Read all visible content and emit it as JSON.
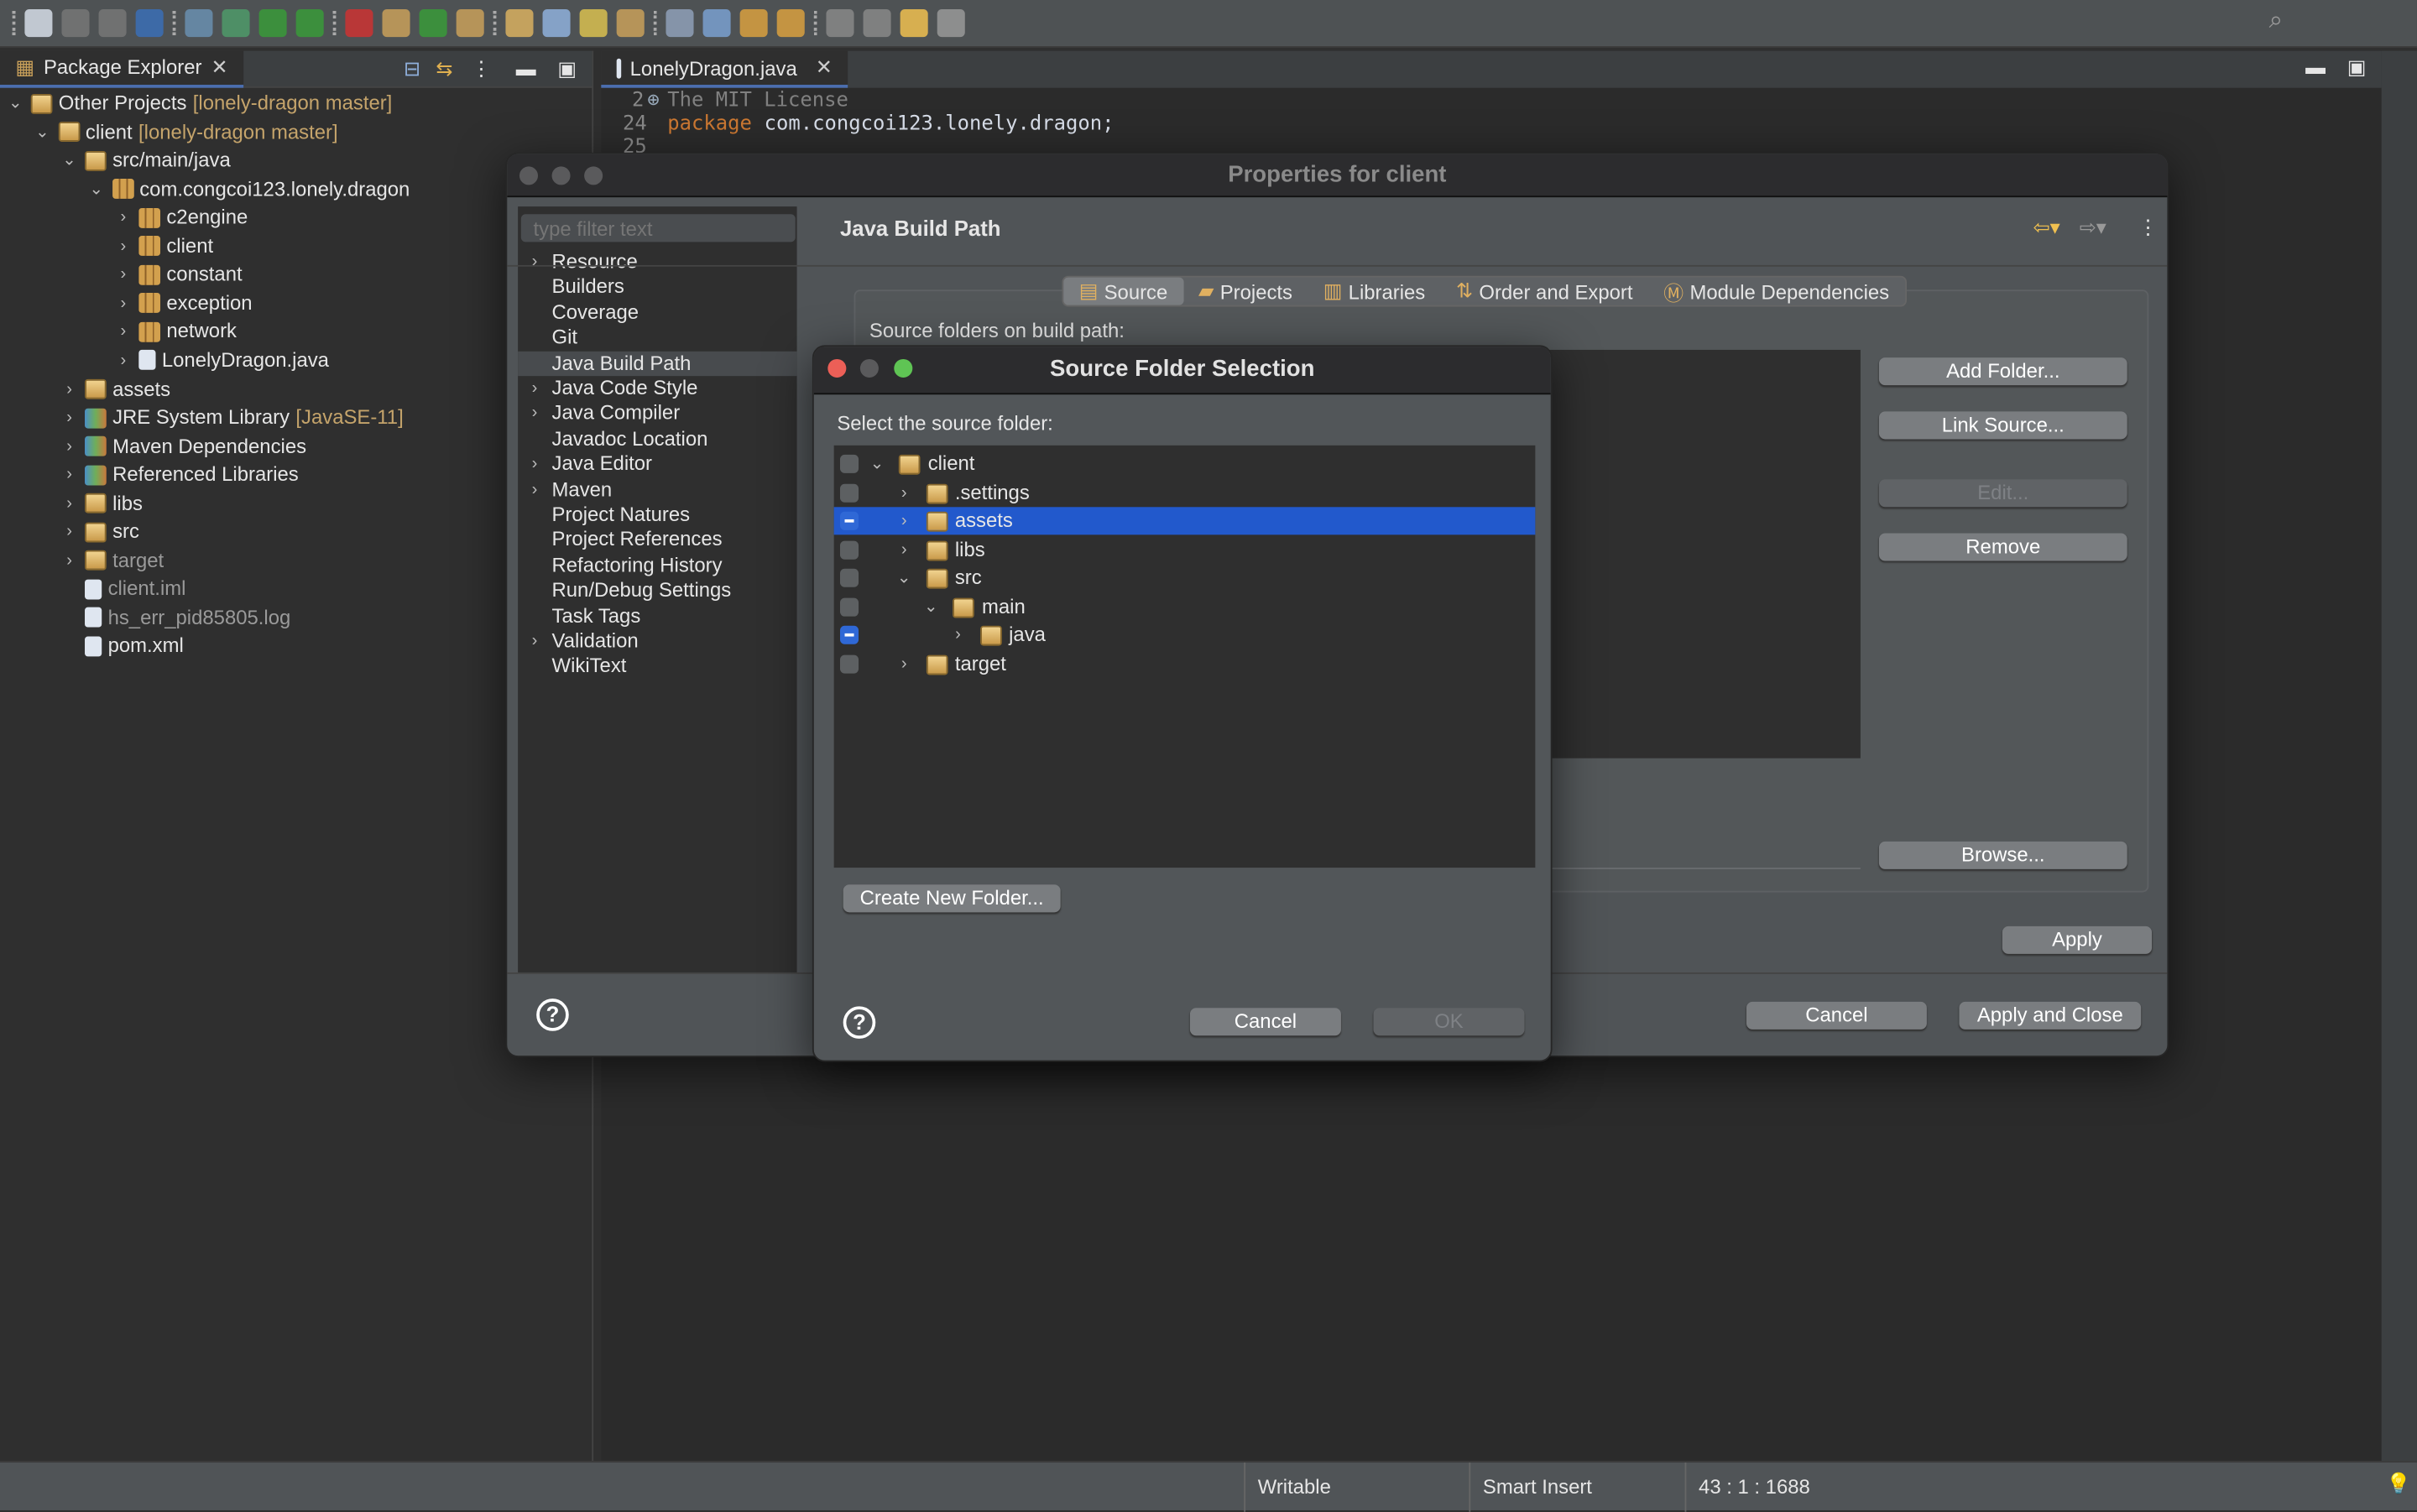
{
  "toolbar": {
    "icons": [
      "new-wizard-icon",
      "save-icon",
      "save-all-icon",
      "open-console-icon",
      "skip-breakpoints-icon",
      "debug-icon",
      "run-icon",
      "coverage-icon",
      "run-external-tool-icon",
      "new-java-package-icon",
      "new-java-class-icon",
      "open-type-icon",
      "search-icon",
      "toggle-breadcrumb-icon",
      "mark-occurrences-icon",
      "word-wrap-icon",
      "block-selection-icon",
      "show-whitespace-icon",
      "next-annotation-icon",
      "previous-annotation-icon",
      "last-edit-icon",
      "back-icon",
      "forward-icon",
      "open-perspective-icon"
    ]
  },
  "package_explorer": {
    "title": "Package Explorer",
    "items": [
      {
        "label": "Other Projects",
        "decoration": "[lonely-dragon master]",
        "indent": 0,
        "chevron": "down",
        "icon": "working-set"
      },
      {
        "label": "client",
        "decoration": "[lonely-dragon master]",
        "indent": 1,
        "chevron": "down",
        "icon": "project"
      },
      {
        "label": "src/main/java",
        "indent": 2,
        "chevron": "down",
        "icon": "source-folder"
      },
      {
        "label": "com.congcoi123.lonely.dragon",
        "indent": 3,
        "chevron": "down",
        "icon": "package"
      },
      {
        "label": "c2engine",
        "indent": 4,
        "chevron": "right",
        "icon": "package"
      },
      {
        "label": "client",
        "indent": 4,
        "chevron": "right",
        "icon": "package"
      },
      {
        "label": "constant",
        "indent": 4,
        "chevron": "right",
        "icon": "package"
      },
      {
        "label": "exception",
        "indent": 4,
        "chevron": "right",
        "icon": "package"
      },
      {
        "label": "network",
        "indent": 4,
        "chevron": "right",
        "icon": "package"
      },
      {
        "label": "LonelyDragon.java",
        "indent": 4,
        "chevron": "right",
        "icon": "java-file"
      },
      {
        "label": "assets",
        "indent": 2,
        "chevron": "right",
        "icon": "source-folder"
      },
      {
        "label": "JRE System Library",
        "decoration": "[JavaSE-11]",
        "indent": 2,
        "chevron": "right",
        "icon": "library"
      },
      {
        "label": "Maven Dependencies",
        "indent": 2,
        "chevron": "right",
        "icon": "library"
      },
      {
        "label": "Referenced Libraries",
        "indent": 2,
        "chevron": "right",
        "icon": "library"
      },
      {
        "label": "libs",
        "indent": 2,
        "chevron": "right",
        "icon": "folder"
      },
      {
        "label": "src",
        "indent": 2,
        "chevron": "right",
        "icon": "folder"
      },
      {
        "label": "target",
        "indent": 2,
        "chevron": "right",
        "icon": "folder",
        "dim": true
      },
      {
        "label": "client.iml",
        "indent": 2,
        "icon": "file",
        "dim": true
      },
      {
        "label": "hs_err_pid85805.log",
        "indent": 2,
        "icon": "file",
        "dim": true
      },
      {
        "label": "pom.xml",
        "indent": 2,
        "icon": "xml-file"
      }
    ]
  },
  "editor": {
    "tab": "LonelyDragon.java",
    "lines": [
      {
        "num": "2",
        "text": "The MIT License",
        "folded": true
      },
      {
        "num": "24",
        "keyword": "package",
        "text": " com.congcoi123.lonely.dragon;"
      },
      {
        "num": "25",
        "text": ""
      }
    ]
  },
  "properties": {
    "title": "Properties for client",
    "filter_placeholder": "type filter text",
    "nav": [
      {
        "label": "Resource",
        "expandable": true
      },
      {
        "label": "Builders"
      },
      {
        "label": "Coverage"
      },
      {
        "label": "Git"
      },
      {
        "label": "Java Build Path",
        "selected": true
      },
      {
        "label": "Java Code Style",
        "expandable": true
      },
      {
        "label": "Java Compiler",
        "expandable": true
      },
      {
        "label": "Javadoc Location"
      },
      {
        "label": "Java Editor",
        "expandable": true
      },
      {
        "label": "Maven",
        "expandable": true
      },
      {
        "label": "Project Natures"
      },
      {
        "label": "Project References"
      },
      {
        "label": "Refactoring History"
      },
      {
        "label": "Run/Debug Settings"
      },
      {
        "label": "Task Tags"
      },
      {
        "label": "Validation",
        "expandable": true
      },
      {
        "label": "WikiText"
      }
    ],
    "page_title": "Java Build Path",
    "tabs": [
      {
        "label": "Source",
        "active": true
      },
      {
        "label": "Projects"
      },
      {
        "label": "Libraries"
      },
      {
        "label": "Order and Export"
      },
      {
        "label": "Module Dependencies"
      }
    ],
    "source_label": "Source folders on build path:",
    "buttons": {
      "add_folder": "Add Folder...",
      "link_source": "Link Source...",
      "edit": "Edit...",
      "remove": "Remove",
      "browse": "Browse...",
      "apply": "Apply",
      "cancel": "Cancel",
      "apply_close": "Apply and Close"
    }
  },
  "source_dialog": {
    "title": "Source Folder Selection",
    "label": "Select the source folder:",
    "tree": [
      {
        "label": "client",
        "indent": 0,
        "chevron": "down",
        "checked": "none",
        "icon": "project"
      },
      {
        "label": ".settings",
        "indent": 1,
        "chevron": "right",
        "checked": "none"
      },
      {
        "label": "assets",
        "indent": 1,
        "chevron": "right",
        "checked": "mixed",
        "selected": true
      },
      {
        "label": "libs",
        "indent": 1,
        "chevron": "right",
        "checked": "none"
      },
      {
        "label": "src",
        "indent": 1,
        "chevron": "down",
        "checked": "none"
      },
      {
        "label": "main",
        "indent": 2,
        "chevron": "down",
        "checked": "none"
      },
      {
        "label": "java",
        "indent": 3,
        "chevron": "right",
        "checked": "mixed"
      },
      {
        "label": "target",
        "indent": 1,
        "chevron": "right",
        "checked": "none"
      }
    ],
    "create_folder": "Create New Folder...",
    "cancel": "Cancel",
    "ok": "OK"
  },
  "status": {
    "writable": "Writable",
    "insert_mode": "Smart Insert",
    "position": "43 : 1 : 1688"
  },
  "colors": {
    "selection": "#2259cc",
    "accent": "#4b6eaf",
    "keyword": "#cc7832"
  }
}
